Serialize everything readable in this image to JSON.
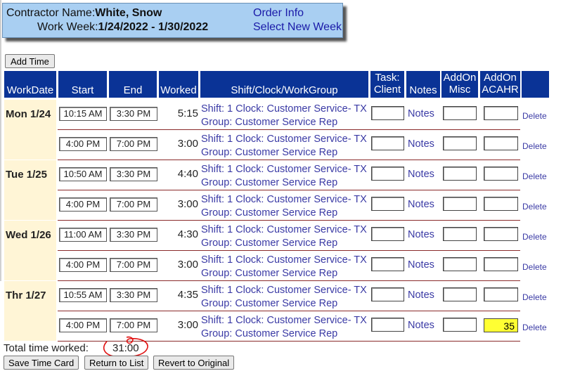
{
  "header": {
    "contractor_label": "Contractor Name:",
    "contractor_value": "White, Snow",
    "week_label": "Work Week:",
    "week_value": "1/24/2022 - 1/30/2022",
    "order_info": "Order Info",
    "select_week": "Select New Week"
  },
  "add_time_label": "Add Time",
  "columns": {
    "workdate": "WorkDate",
    "start": "Start",
    "end": "End",
    "worked": "Worked",
    "shift": "Shift/Clock/WorkGroup",
    "task_line1": "Task:",
    "task_line2": "Client",
    "notes": "Notes",
    "misc_line1": "AddOn",
    "misc_line2": "Misc",
    "acahr_line1": "AddOn",
    "acahr_line2": "ACAHR"
  },
  "rows": [
    {
      "day": "Mon 1/24",
      "start": "10:15 AM",
      "end": "3:30 PM",
      "worked": "5:15",
      "shift_line1": "Shift: 1 Clock: Customer Service- TX",
      "shift_line2": "Group: Customer Service Rep",
      "notes": "Notes",
      "acahr": "",
      "delete": "Delete"
    },
    {
      "day": "",
      "start": "4:00 PM",
      "end": "7:00 PM",
      "worked": "3:00",
      "shift_line1": "Shift: 1 Clock: Customer Service- TX",
      "shift_line2": "Group: Customer Service Rep",
      "notes": "Notes",
      "acahr": "",
      "delete": "Delete"
    },
    {
      "day": "Tue 1/25",
      "start": "10:50 AM",
      "end": "3:30 PM",
      "worked": "4:40",
      "shift_line1": "Shift: 1 Clock: Customer Service- TX",
      "shift_line2": "Group: Customer Service Rep",
      "notes": "Notes",
      "acahr": "",
      "delete": "Delete"
    },
    {
      "day": "",
      "start": "4:00 PM",
      "end": "7:00 PM",
      "worked": "3:00",
      "shift_line1": "Shift: 1 Clock: Customer Service- TX",
      "shift_line2": "Group: Customer Service Rep",
      "notes": "Notes",
      "acahr": "",
      "delete": "Delete"
    },
    {
      "day": "Wed 1/26",
      "start": "11:00 AM",
      "end": "3:30 PM",
      "worked": "4:30",
      "shift_line1": "Shift: 1 Clock: Customer Service- TX",
      "shift_line2": "Group: Customer Service Rep",
      "notes": "Notes",
      "acahr": "",
      "delete": "Delete"
    },
    {
      "day": "",
      "start": "4:00 PM",
      "end": "7:00 PM",
      "worked": "3:00",
      "shift_line1": "Shift: 1 Clock: Customer Service- TX",
      "shift_line2": "Group: Customer Service Rep",
      "notes": "Notes",
      "acahr": "",
      "delete": "Delete"
    },
    {
      "day": "Thr 1/27",
      "start": "10:55 AM",
      "end": "3:30 PM",
      "worked": "4:35",
      "shift_line1": "Shift: 1 Clock: Customer Service- TX",
      "shift_line2": "Group: Customer Service Rep",
      "notes": "Notes",
      "acahr": "",
      "delete": "Delete"
    },
    {
      "day": "",
      "start": "4:00 PM",
      "end": "7:00 PM",
      "worked": "3:00",
      "shift_line1": "Shift: 1 Clock: Customer Service- TX",
      "shift_line2": "Group: Customer Service Rep",
      "notes": "Notes",
      "acahr": "35",
      "delete": "Delete"
    }
  ],
  "total_label": "Total time worked:",
  "total_value": "31:00",
  "buttons": {
    "save": "Save Time Card",
    "return": "Return to List",
    "revert": "Revert to Original"
  },
  "colors": {
    "header_bg": "#0a3396",
    "info_box_bg": "#a9cff2",
    "day_bg": "#fff5d6",
    "highlight": "#ffff33",
    "annotation": "#e01010"
  }
}
